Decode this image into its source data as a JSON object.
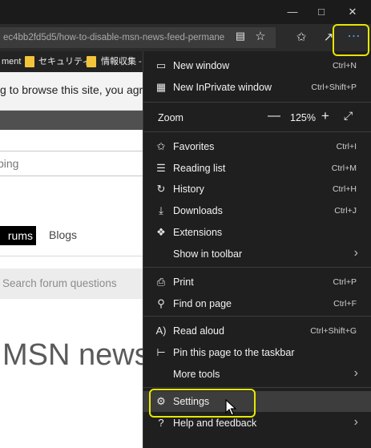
{
  "titlebar": {
    "minimize_icon": "minimize-icon",
    "maximize_icon": "maximize-icon",
    "close_icon": "close-icon"
  },
  "address_bar": {
    "url": "ec4bb2fd5d5/how-to-disable-msn-news-feed-permane"
  },
  "favorites_bar": {
    "items": [
      "ment",
      "セキュリティ",
      "情報収集 -"
    ]
  },
  "page": {
    "cookie_notice": "g to browse this site, you agr",
    "search_box": "bing",
    "tab_forums": "rums",
    "tab_blogs": "Blogs",
    "forum_search_placeholder": "Search forum questions",
    "article_title": "MSN news"
  },
  "menu": {
    "new_window": "New window",
    "new_window_shortcut": "Ctrl+N",
    "inprivate": "New InPrivate window",
    "inprivate_shortcut": "Ctrl+Shift+P",
    "zoom_label": "Zoom",
    "zoom_value": "125%",
    "zoom_minus": "—",
    "zoom_plus": "+",
    "favorites": "Favorites",
    "favorites_shortcut": "Ctrl+I",
    "reading_list": "Reading list",
    "reading_list_shortcut": "Ctrl+M",
    "history": "History",
    "history_shortcut": "Ctrl+H",
    "downloads": "Downloads",
    "downloads_shortcut": "Ctrl+J",
    "extensions": "Extensions",
    "show_in_toolbar": "Show in toolbar",
    "print": "Print",
    "print_shortcut": "Ctrl+P",
    "find_on_page": "Find on page",
    "find_on_page_shortcut": "Ctrl+F",
    "read_aloud": "Read aloud",
    "read_aloud_shortcut": "Ctrl+Shift+G",
    "pin_taskbar": "Pin this page to the taskbar",
    "more_tools": "More tools",
    "settings": "Settings",
    "help_feedback": "Help and feedback"
  },
  "colors": {
    "highlight": "#e6e600",
    "menu_bg": "#1f1f1f",
    "titlebar_bg": "#1b1b1b"
  }
}
